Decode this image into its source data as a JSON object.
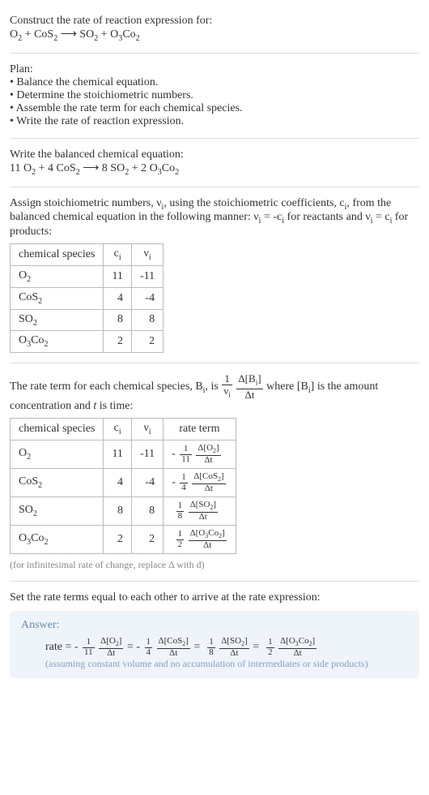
{
  "prompt_title": "Construct the rate of reaction expression for:",
  "unbalanced_eq_html": "O<sub>2</sub> + CoS<sub>2</sub> ⟶ SO<sub>2</sub> + O<sub>3</sub>Co<sub>2</sub>",
  "plan_title": "Plan:",
  "plan_items": [
    "Balance the chemical equation.",
    "Determine the stoichiometric numbers.",
    "Assemble the rate term for each chemical species.",
    "Write the rate of reaction expression."
  ],
  "balanced_title": "Write the balanced chemical equation:",
  "balanced_eq_html": "11 O<sub>2</sub> + 4 CoS<sub>2</sub> ⟶ 8 SO<sub>2</sub> + 2 O<sub>3</sub>Co<sub>2</sub>",
  "assign_text_html": "Assign stoichiometric numbers, ν<sub>i</sub>, using the stoichiometric coefficients, c<sub>i</sub>, from the balanced chemical equation in the following manner: ν<sub>i</sub> = -c<sub>i</sub> for reactants and ν<sub>i</sub> = c<sub>i</sub> for products:",
  "table1": {
    "headers": {
      "species": "chemical species",
      "ci": "c<sub>i</sub>",
      "vi": "ν<sub>i</sub>"
    },
    "rows": [
      {
        "species": "O<sub>2</sub>",
        "ci": "11",
        "vi": "-11"
      },
      {
        "species": "CoS<sub>2</sub>",
        "ci": "4",
        "vi": "-4"
      },
      {
        "species": "SO<sub>2</sub>",
        "ci": "8",
        "vi": "8"
      },
      {
        "species": "O<sub>3</sub>Co<sub>2</sub>",
        "ci": "2",
        "vi": "2"
      }
    ]
  },
  "rateterm_intro_pre": "The rate term for each chemical species, B<sub>i</sub>, is ",
  "rateterm_intro_post": " where [B<sub>i</sub>] is the amount concentration and <i>t</i> is time:",
  "rateterm_frac": {
    "outer_n": "1",
    "outer_d": "ν<sub>i</sub>",
    "inner_n": "Δ[B<sub>i</sub>]",
    "inner_d": "Δt"
  },
  "table2": {
    "headers": {
      "species": "chemical species",
      "ci": "c<sub>i</sub>",
      "vi": "ν<sub>i</sub>",
      "rate": "rate term"
    },
    "rows": [
      {
        "species": "O<sub>2</sub>",
        "ci": "11",
        "vi": "-11",
        "sign": "-",
        "fn": "1",
        "fd": "11",
        "dn": "Δ[O<sub>2</sub>]",
        "dd": "Δt"
      },
      {
        "species": "CoS<sub>2</sub>",
        "ci": "4",
        "vi": "-4",
        "sign": "-",
        "fn": "1",
        "fd": "4",
        "dn": "Δ[CoS<sub>2</sub>]",
        "dd": "Δt"
      },
      {
        "species": "SO<sub>2</sub>",
        "ci": "8",
        "vi": "8",
        "sign": "",
        "fn": "1",
        "fd": "8",
        "dn": "Δ[SO<sub>2</sub>]",
        "dd": "Δt"
      },
      {
        "species": "O<sub>3</sub>Co<sub>2</sub>",
        "ci": "2",
        "vi": "2",
        "sign": "",
        "fn": "1",
        "fd": "2",
        "dn": "Δ[O<sub>3</sub>Co<sub>2</sub>]",
        "dd": "Δt"
      }
    ]
  },
  "inf_note": "(for infinitesimal rate of change, replace Δ with d)",
  "set_equal_text": "Set the rate terms equal to each other to arrive at the rate expression:",
  "answer_label": "Answer:",
  "answer_prefix": "rate = ",
  "answer_terms": [
    {
      "sign": "-",
      "fn": "1",
      "fd": "11",
      "dn": "Δ[O<sub>2</sub>]",
      "dd": "Δt"
    },
    {
      "sign": "-",
      "fn": "1",
      "fd": "4",
      "dn": "Δ[CoS<sub>2</sub>]",
      "dd": "Δt"
    },
    {
      "sign": "",
      "fn": "1",
      "fd": "8",
      "dn": "Δ[SO<sub>2</sub>]",
      "dd": "Δt"
    },
    {
      "sign": "",
      "fn": "1",
      "fd": "2",
      "dn": "Δ[O<sub>3</sub>Co<sub>2</sub>]",
      "dd": "Δt"
    }
  ],
  "answer_note": "(assuming constant volume and no accumulation of intermediates or side products)"
}
